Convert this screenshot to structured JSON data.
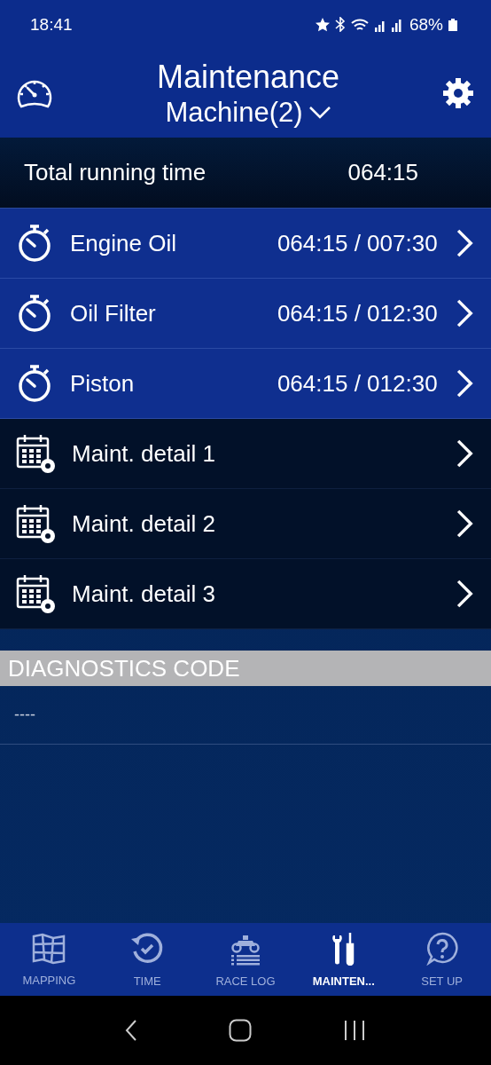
{
  "status_bar": {
    "time": "18:41",
    "battery": "68%"
  },
  "header": {
    "title": "Maintenance",
    "machine": "Machine(2)"
  },
  "total": {
    "label": "Total running time",
    "value": "064:15"
  },
  "items": [
    {
      "kind": "timer",
      "label": "Engine Oil",
      "value": "064:15 / 007:30"
    },
    {
      "kind": "timer",
      "label": "Oil Filter",
      "value": "064:15 / 012:30"
    },
    {
      "kind": "timer",
      "label": "Piston",
      "value": "064:15 / 012:30"
    },
    {
      "kind": "detail",
      "label": "Maint. detail 1"
    },
    {
      "kind": "detail",
      "label": "Maint. detail 2"
    },
    {
      "kind": "detail",
      "label": "Maint. detail 3"
    }
  ],
  "diagnostics": {
    "title": "DIAGNOSTICS CODE",
    "code": "----"
  },
  "tabs": [
    {
      "label": "MAPPING",
      "kind": "map",
      "selected": false
    },
    {
      "label": "TIME",
      "kind": "clock",
      "selected": false
    },
    {
      "label": "RACE LOG",
      "kind": "bike",
      "selected": false
    },
    {
      "label": "MAINTEN...",
      "kind": "tools",
      "selected": true
    },
    {
      "label": "SET UP",
      "kind": "help",
      "selected": false
    }
  ]
}
